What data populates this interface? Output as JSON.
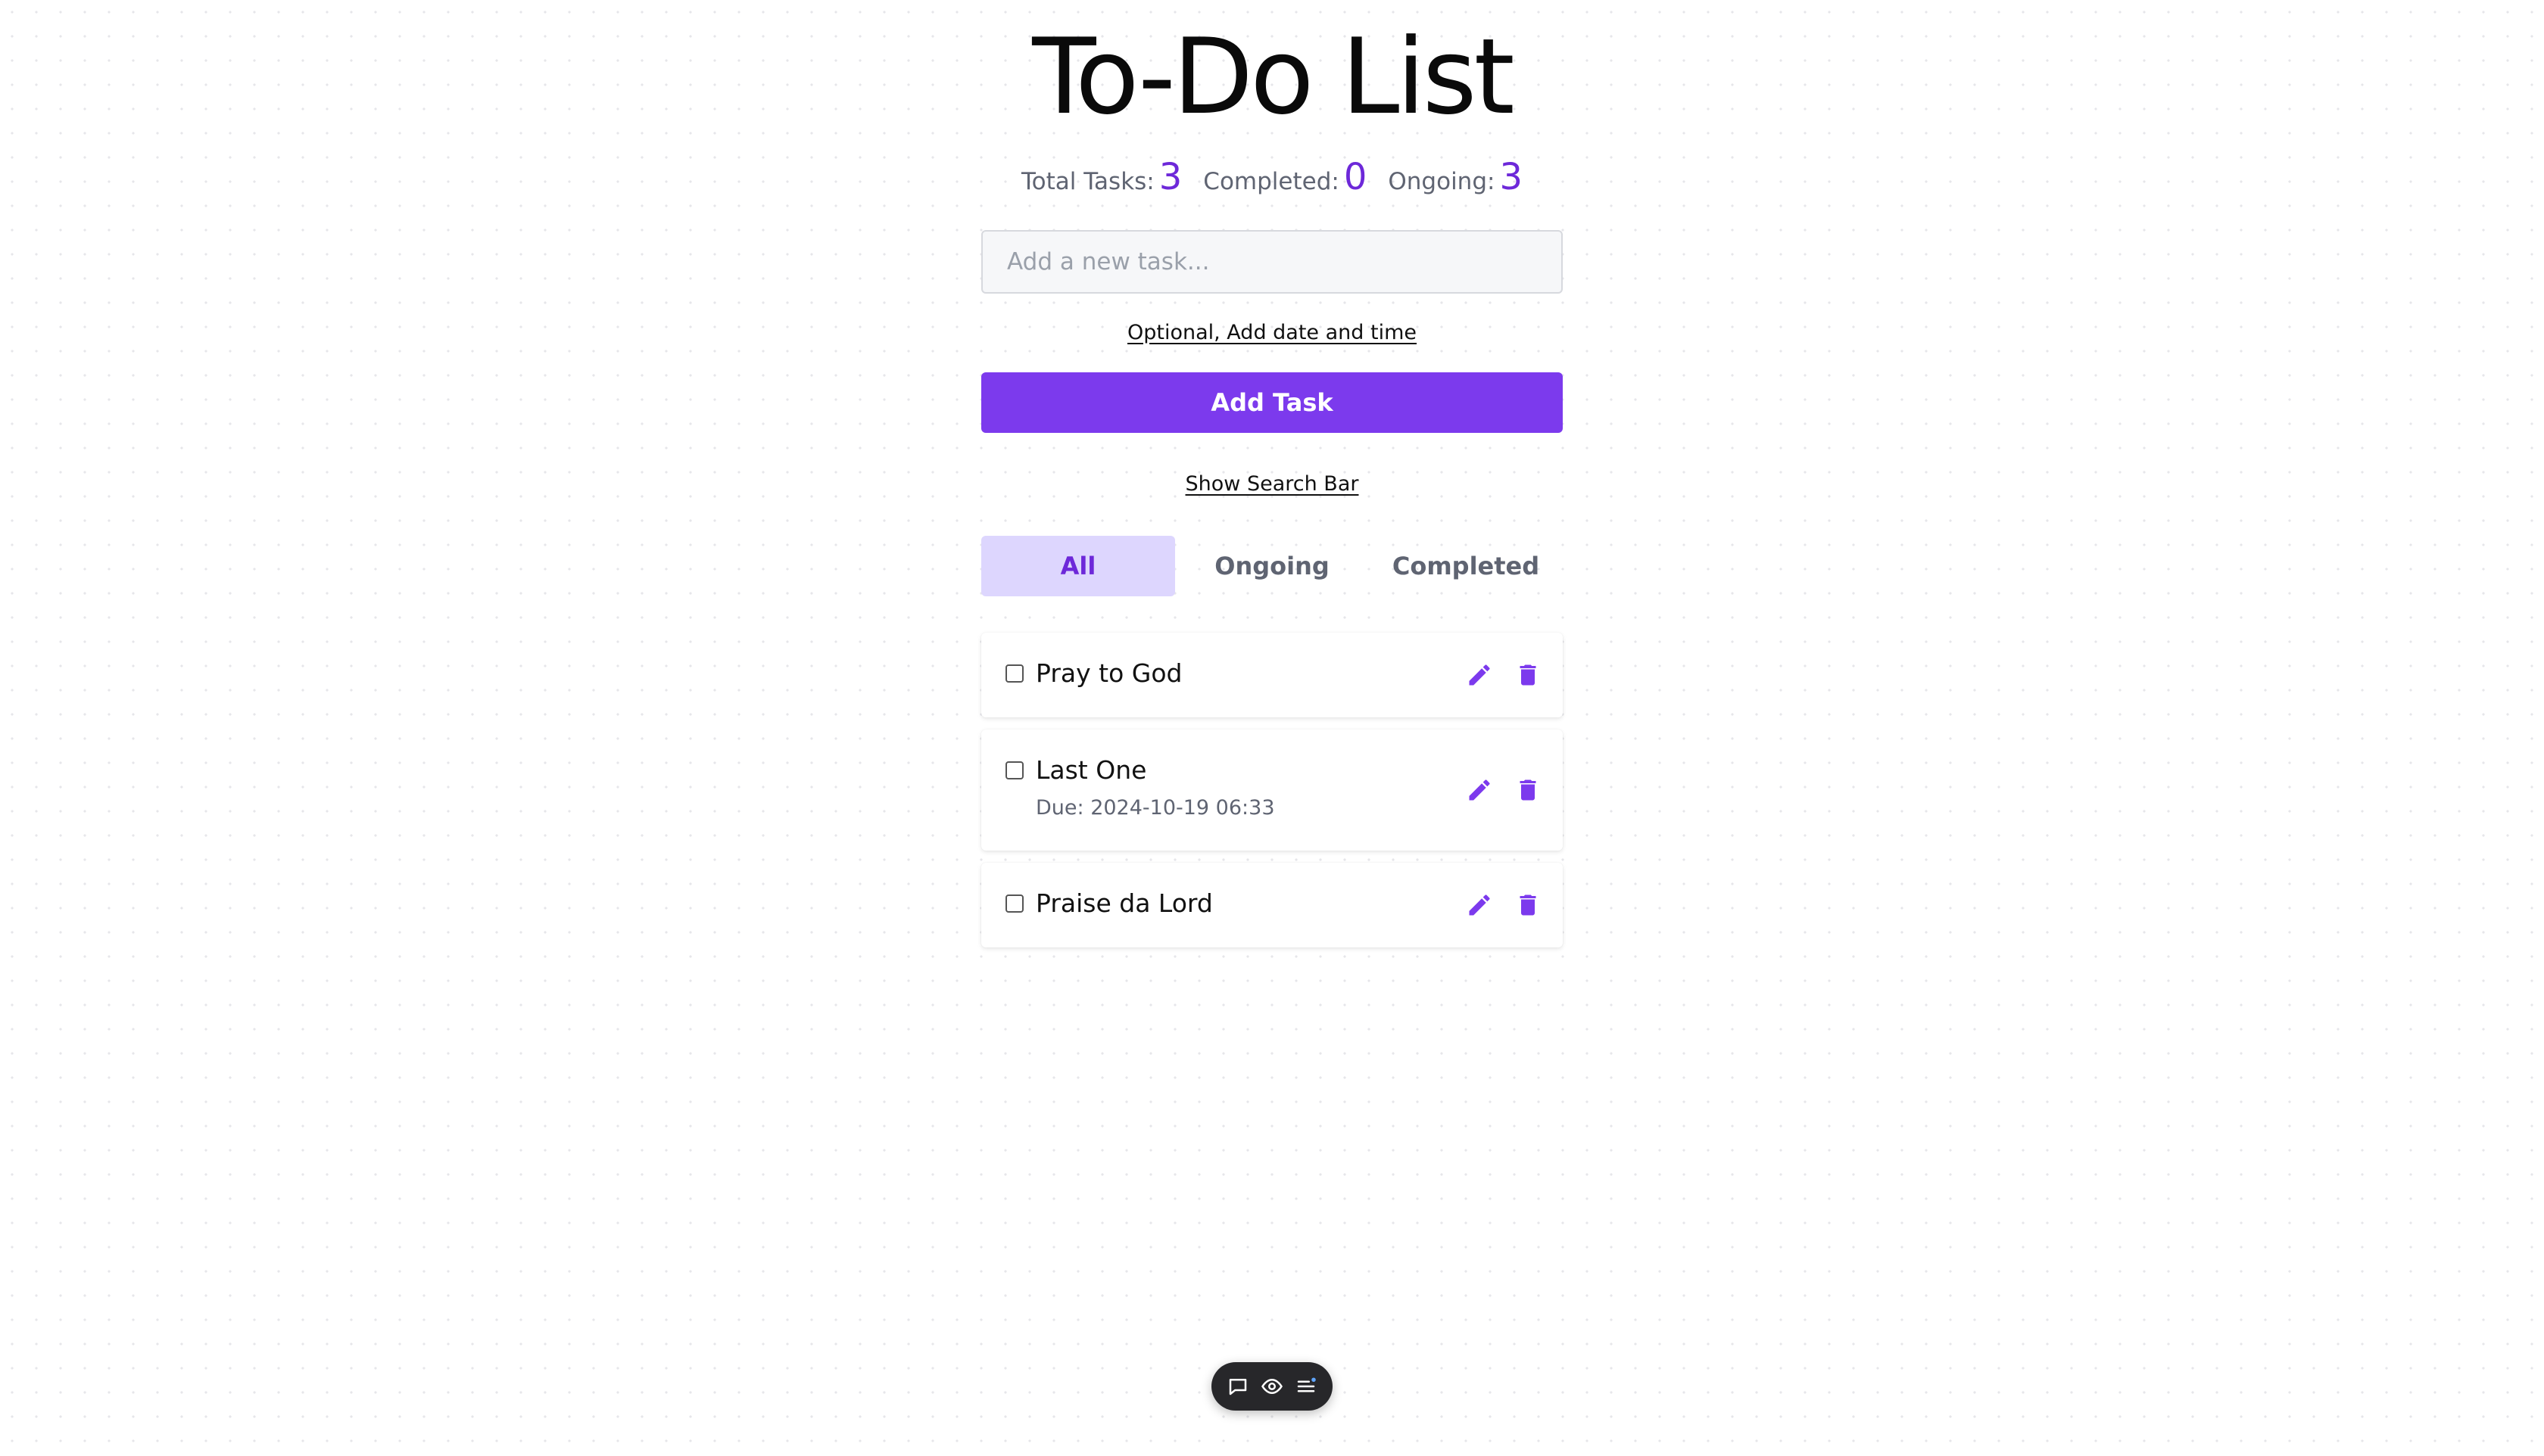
{
  "header": {
    "title": "To-Do List"
  },
  "stats": {
    "total_label": "Total Tasks:",
    "total_value": "3",
    "completed_label": "Completed:",
    "completed_value": "0",
    "ongoing_label": "Ongoing:",
    "ongoing_value": "3"
  },
  "form": {
    "input_placeholder": "Add a new task...",
    "input_value": "",
    "date_link": "Optional, Add date and time",
    "add_button": "Add Task",
    "search_link": "Show Search Bar"
  },
  "filters": {
    "tabs": [
      {
        "label": "All",
        "active": true
      },
      {
        "label": "Ongoing",
        "active": false
      },
      {
        "label": "Completed",
        "active": false
      }
    ]
  },
  "tasks": [
    {
      "text": "Pray to God",
      "due": "",
      "checked": false
    },
    {
      "text": "Last One",
      "due": "Due: 2024-10-19 06:33",
      "checked": false
    },
    {
      "text": "Praise da Lord",
      "due": "",
      "checked": false
    }
  ],
  "icons": {
    "edit": "pencil-icon",
    "delete": "trash-icon",
    "toolbar": [
      "comment-icon",
      "eye-icon",
      "menu-list-icon"
    ]
  },
  "colors": {
    "accent": "#7c3aed",
    "accent_text": "#6d28d9",
    "tab_active_bg": "#ddd6fe",
    "toolbar_bg": "#27272a"
  }
}
